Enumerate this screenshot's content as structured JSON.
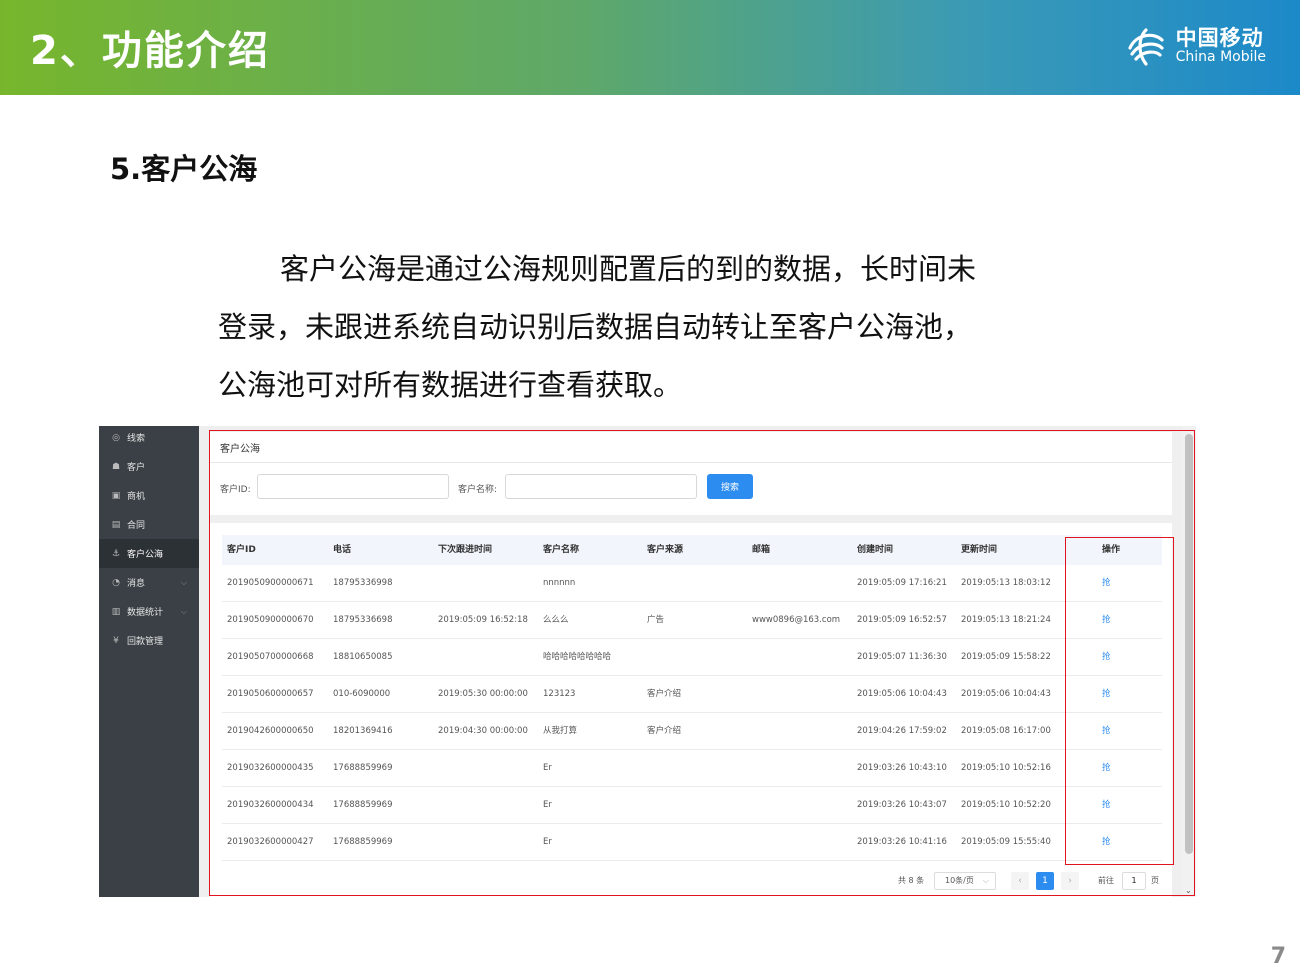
{
  "header": {
    "title": "2、功能介绍",
    "logo_cn": "中国移动",
    "logo_en": "China Mobile"
  },
  "section_title": "5.客户公海",
  "paragraph": [
    "客户公海是通过公海规则配置后的到的数据，长时间未",
    "登录，未跟进系统自动识别后数据自动转让至客户公海池，",
    "公海池可对所有数据进行查看获取。"
  ],
  "page_number": "7",
  "sidebar": {
    "items": [
      {
        "label": "线索",
        "icon": "clue-icon",
        "glyph": "◎"
      },
      {
        "label": "客户",
        "icon": "customer-icon",
        "glyph": "☗"
      },
      {
        "label": "商机",
        "icon": "opportunity-icon",
        "glyph": "▣"
      },
      {
        "label": "合同",
        "icon": "contract-icon",
        "glyph": "▤"
      },
      {
        "label": "客户公海",
        "icon": "anchor-icon",
        "glyph": "⚓"
      },
      {
        "label": "消息",
        "icon": "message-icon",
        "glyph": "◔"
      },
      {
        "label": "数据统计",
        "icon": "stats-icon",
        "glyph": "▥"
      },
      {
        "label": "回款管理",
        "icon": "yen-icon",
        "glyph": "¥"
      }
    ],
    "active_index": 4
  },
  "search_panel": {
    "title": "客户公海",
    "id_label": "客户ID:",
    "name_label": "客户名称:",
    "search_button": "搜索"
  },
  "table": {
    "columns": [
      "客户ID",
      "电话",
      "下次跟进时间",
      "客户名称",
      "客户来源",
      "邮箱",
      "创建时间",
      "更新时间",
      "操作"
    ],
    "rows": [
      [
        "2019050900000671",
        "18795336998",
        "",
        "nnnnnn",
        "",
        "",
        "2019:05:09 17:16:21",
        "2019:05:13 18:03:12",
        "抢"
      ],
      [
        "2019050900000670",
        "18795336698",
        "2019:05:09 16:52:18",
        "么么么",
        "广告",
        "www0896@163.com",
        "2019:05:09 16:52:57",
        "2019:05:13 18:21:24",
        "抢"
      ],
      [
        "2019050700000668",
        "18810650085",
        "",
        "哈哈哈哈哈哈哈哈",
        "",
        "",
        "2019:05:07 11:36:30",
        "2019:05:09 15:58:22",
        "抢"
      ],
      [
        "2019050600000657",
        "010-6090000",
        "2019:05:30 00:00:00",
        "123123",
        "客户介绍",
        "",
        "2019:05:06 10:04:43",
        "2019:05:06 10:04:43",
        "抢"
      ],
      [
        "2019042600000650",
        "18201369416",
        "2019:04:30 00:00:00",
        "从我打算",
        "客户介绍",
        "",
        "2019:04:26 17:59:02",
        "2019:05:08 16:17:00",
        "抢"
      ],
      [
        "2019032600000435",
        "17688859969",
        "",
        "Er",
        "",
        "",
        "2019:03:26 10:43:10",
        "2019:05:10 10:52:16",
        "抢"
      ],
      [
        "2019032600000434",
        "17688859969",
        "",
        "Er",
        "",
        "",
        "2019:03:26 10:43:07",
        "2019:05:10 10:52:20",
        "抢"
      ],
      [
        "2019032600000427",
        "17688859969",
        "",
        "Er",
        "",
        "",
        "2019:03:26 10:41:16",
        "2019:05:09 15:55:40",
        "抢"
      ]
    ]
  },
  "pagination": {
    "total": "共 8 条",
    "page_size": "10条/页",
    "current_page": "1",
    "prev": "‹",
    "next": "›",
    "goto_label": "前往",
    "goto_value": "1",
    "page_suffix": "页"
  },
  "colors": {
    "highlight_frame": "#e0141e",
    "primary_button": "#2d8cf0"
  }
}
